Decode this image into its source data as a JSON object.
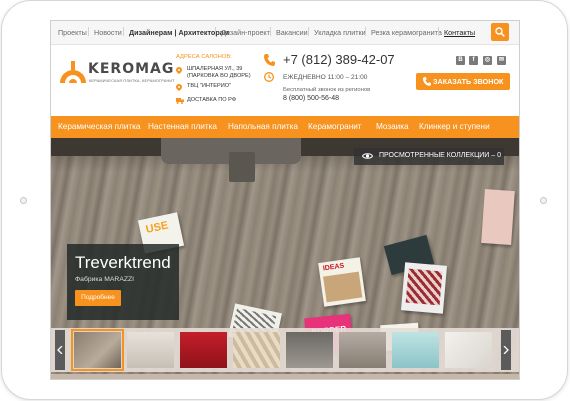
{
  "topnav": {
    "items": [
      "Проекты",
      "Новости",
      "Дизайнерам | Архитекторам",
      "Дизайн-проект",
      "Вакансии",
      "Укладка плитки",
      "Резка керамогранита",
      "Контакты"
    ]
  },
  "logo": {
    "name": "KEROMAG",
    "tagline": "КЕРАМИЧЕСКАЯ ПЛИТКА, КЕРАМОГРАНИТ"
  },
  "salons": {
    "title": "АДРЕСА САЛОНОВ:",
    "address1": "ШПАЛЕРНАЯ УЛ., 39",
    "address1_note": "(ПАРКОВКА ВО ДВОРЕ)",
    "address2": "ТВЦ \"ИНТЕРИО\"",
    "delivery": "ДОСТАВКА ПО РФ"
  },
  "contact": {
    "phone": "+7 (812) 389-42-07",
    "hours": "ЕЖЕДНЕВНО 11:00 – 21:00",
    "free_label": "Бесплатный звонок из регионов",
    "free_phone": "8 (800) 500-56-48"
  },
  "social": [
    "В",
    "f",
    "◎",
    "✉"
  ],
  "callback_label": "ЗАКАЗАТЬ ЗВОНОК",
  "categories": [
    "Керамическая плитка",
    "Настенная плитка",
    "Напольная плитка",
    "Керамогранит",
    "Мозаика",
    "Клинкер и ступени"
  ],
  "viewed_label": "ПРОСМОТРЕННЫЕ КОЛЛЕКЦИИ – 0",
  "hero": {
    "title": "Treverktrend",
    "factory": "Фабрика MARAZZI",
    "button": "Подробнее"
  },
  "magazines": [
    "USE",
    "IDEAS",
    "BORDER"
  ],
  "colors": {
    "accent": "#f7921e",
    "text": "#333333",
    "nav_bg": "#f6f6f6"
  }
}
